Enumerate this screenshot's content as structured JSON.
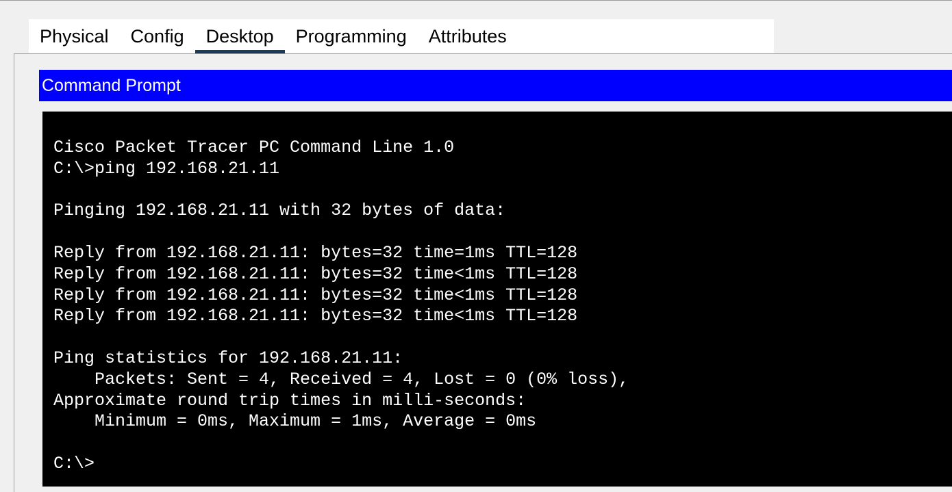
{
  "tabs": [
    {
      "label": "Physical",
      "active": false
    },
    {
      "label": "Config",
      "active": false
    },
    {
      "label": "Desktop",
      "active": true
    },
    {
      "label": "Programming",
      "active": false
    },
    {
      "label": "Attributes",
      "active": false
    }
  ],
  "command_prompt": {
    "title": "Command Prompt",
    "lines": [
      "Cisco Packet Tracer PC Command Line 1.0",
      "C:\\>ping 192.168.21.11",
      "",
      "Pinging 192.168.21.11 with 32 bytes of data:",
      "",
      "Reply from 192.168.21.11: bytes=32 time=1ms TTL=128",
      "Reply from 192.168.21.11: bytes=32 time<1ms TTL=128",
      "Reply from 192.168.21.11: bytes=32 time<1ms TTL=128",
      "Reply from 192.168.21.11: bytes=32 time<1ms TTL=128",
      "",
      "Ping statistics for 192.168.21.11:",
      "    Packets: Sent = 4, Received = 4, Lost = 0 (0% loss),",
      "Approximate round trip times in milli-seconds:",
      "    Minimum = 0ms, Maximum = 1ms, Average = 0ms",
      "",
      "C:\\>"
    ]
  },
  "colors": {
    "title_bar": "#0000ff",
    "terminal_bg": "#000000",
    "terminal_fg": "#ffffff",
    "active_tab_underline": "#1c3a57"
  }
}
